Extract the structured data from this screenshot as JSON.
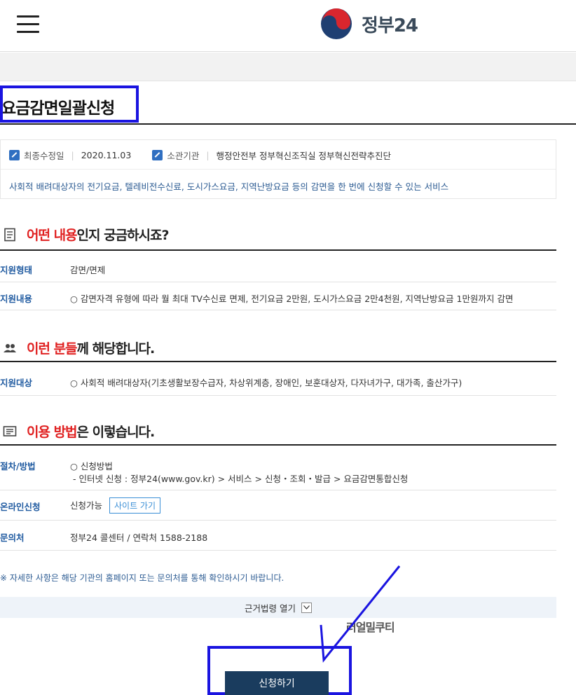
{
  "header": {
    "logo_text": "정부24"
  },
  "page": {
    "title": "요금감면일괄신청"
  },
  "info": {
    "updated_label": "최종수정일",
    "updated_value": "2020.11.03",
    "agency_label": "소관기관",
    "agency_value": "행정안전부 정부혁신조직실 정부혁신전략추진단",
    "description": "사회적 배려대상자의 전기요금, 텔레비전수신료, 도시가스요금, 지역난방요금 등의 감면을 한 번에 신청할 수 있는 서비스"
  },
  "sections": {
    "what": {
      "highlight": "어떤 내용",
      "rest": "인지 궁금하시죠?",
      "rows": [
        {
          "label": "지원형태",
          "value": "감면/면제"
        },
        {
          "label": "지원내용",
          "value": "○ 감면자격 유형에 따라 월 최대 TV수신료 면제, 전기요금 2만원, 도시가스요금 2만4천원, 지역난방요금 1만원까지 감면"
        }
      ]
    },
    "who": {
      "highlight": "이런 분들",
      "rest": "께 해당합니다.",
      "rows": [
        {
          "label": "지원대상",
          "value": "○ 사회적 배려대상자(기초생활보장수급자, 차상위계층, 장애인, 보훈대상자, 다자녀가구, 대가족, 출산가구)"
        }
      ]
    },
    "how": {
      "highlight": "이용 방법",
      "rest": "은 이렇습니다.",
      "rows": [
        {
          "label": "절차/방법",
          "value": "○ 신청방법",
          "value2": "- 인터넷 신청 : 정부24(www.gov.kr) > 서비스 > 신청・조회・발급 > 요금감면통합신청"
        },
        {
          "label": "온라인신청",
          "value": "신청가능",
          "button": "사이트 가기"
        },
        {
          "label": "문의처",
          "value": "정부24 콜센터 / 연락처 1588-2188"
        }
      ]
    }
  },
  "note": "※ 자세한 사항은 해당 기관의 홈페이지 또는 문의처를 통해 확인하시기 바랍니다.",
  "law_toggle_label": "근거법령 열기",
  "overlay_text": "러얼밀쿠티",
  "apply_button": "신청하기",
  "colors": {
    "highlight": "#e02020",
    "annotation": "#1a14e0",
    "apply_bg": "#1a3c5e"
  }
}
